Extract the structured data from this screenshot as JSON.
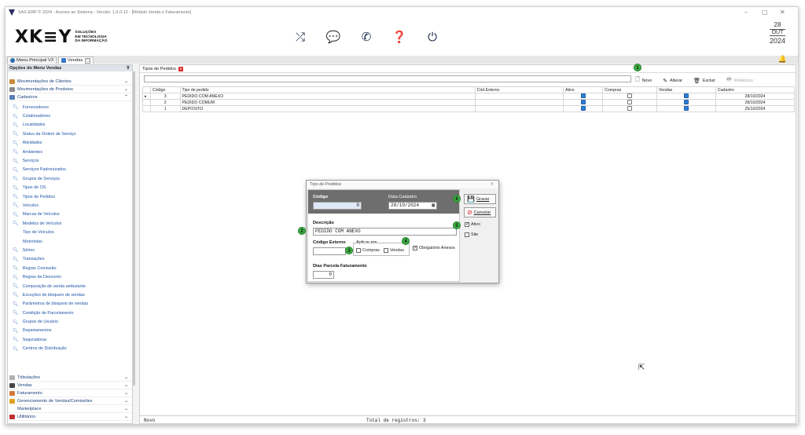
{
  "window": {
    "title": "SAX ERP © 2024 - Acesso ao Sistema - Versão: 1.6.0.12 - [Módulo Venda e Faturamento]"
  },
  "brand": {
    "logo": "XK≡Y",
    "tagline": [
      "SOLUÇÕES",
      "EM TECNOLOGIA",
      "DA INFORMAÇÃO"
    ]
  },
  "header_icons": [
    "shuffle-icon",
    "chat-icon",
    "whatsapp-icon",
    "help-icon",
    "power-icon"
  ],
  "date": {
    "day": "28",
    "month": "OUT",
    "year": "2024"
  },
  "tabs": [
    {
      "label": "Menu Principal V3"
    },
    {
      "label": "Vendas"
    }
  ],
  "sidebar": {
    "title": "Opções do Menu Vendas",
    "groups_top": [
      {
        "label": "Movimentações de Clientes",
        "color": "#c9883a"
      },
      {
        "label": "Movimentações de Produtos",
        "color": "#8a8a8a"
      },
      {
        "label": "Cadastros",
        "color": "#5a7fb5"
      }
    ],
    "items": [
      "Fornecedores",
      "Colaboradores",
      "Localidades",
      "Status da Ordem de Serviço",
      "Atividades",
      "Ambientes",
      "Serviços",
      "Serviços Padronizados",
      "Grupos de Serviços",
      "Tipos de OS",
      "Tipos de Pedidos",
      "Veículos",
      "Marcas de Veículos",
      "Modelos de Veículos",
      "Tipo de Veículos",
      "Motoristas",
      "Séries",
      "Transações",
      "Regras Comissão",
      "Regras de Desconto",
      "Composição de venda ambulante",
      "Exceções de bloqueio de vendas",
      "Parâmetros de bloqueio de vendas",
      "Condição de Parcelamento",
      "Grupos de Usuário",
      "Departamentos",
      "Seguradoras",
      "Centros de Distribuição"
    ],
    "plain_items": [
      "Tipo de Veículos",
      "Motoristas"
    ],
    "groups_bottom": [
      {
        "label": "Tributações",
        "color": "#b0b0b0"
      },
      {
        "label": "Vendas",
        "color": "#444444"
      },
      {
        "label": "Faturamento",
        "color": "#d07a3a"
      },
      {
        "label": "Gerenciamento de Vendas/Comissões",
        "color": "#e0a020"
      },
      {
        "label": "Marketplace",
        "color": "#ffffff"
      },
      {
        "label": "Utilitários",
        "color": "#c03030"
      }
    ]
  },
  "content": {
    "tab_label": "Tipos de Pedidos",
    "toolbar": {
      "novo": "Novo",
      "alterar": "Alterar",
      "excluir": "Excluir",
      "relatorios": "Relatórios"
    },
    "columns": [
      "Código",
      "Tipo de pedido",
      "Cód.Externo",
      "Ativo",
      "Compras",
      "Vendas",
      "Cadastro"
    ],
    "rows": [
      {
        "codigo": "3",
        "tipo": "PEDIDO COM ANEXO",
        "cod_externo": "",
        "ativo": true,
        "compras": false,
        "vendas": true,
        "cadastro": "28/10/2024"
      },
      {
        "codigo": "2",
        "tipo": "PEDIDO COMUM",
        "cod_externo": "",
        "ativo": true,
        "compras": false,
        "vendas": true,
        "cadastro": "28/10/2024"
      },
      {
        "codigo": "1",
        "tipo": "DEPOSITO",
        "cod_externo": "",
        "ativo": true,
        "compras": false,
        "vendas": true,
        "cadastro": "25/10/2024"
      }
    ],
    "status": {
      "mode": "Novo",
      "total": "Total de registros: 3"
    }
  },
  "dialog": {
    "title": "Tipo de Pedidos",
    "codigo_label": "Código",
    "codigo_value": "0",
    "data_label": "Data Cadastro",
    "data_value": "28/10/2024",
    "descricao_label": "Descrição",
    "descricao_value": "PEDIDO COM ANEXO",
    "cod_externo_label": "Código Externo",
    "cod_externo_value": "",
    "aplicar_label": "Aplicar em",
    "compras_label": "Compras",
    "vendas_label": "Vendas",
    "obrigatorio_label": "Obrigatório Anexos",
    "dias_label": "Dias Parcela Faturamento",
    "dias_value": "0",
    "gravar_label": "Gravar",
    "cancelar_label": "Cancelar",
    "ativo_label": "Ativo",
    "site_label": "Site"
  },
  "badges": [
    "1",
    "2",
    "3",
    "4",
    "5",
    "6"
  ]
}
